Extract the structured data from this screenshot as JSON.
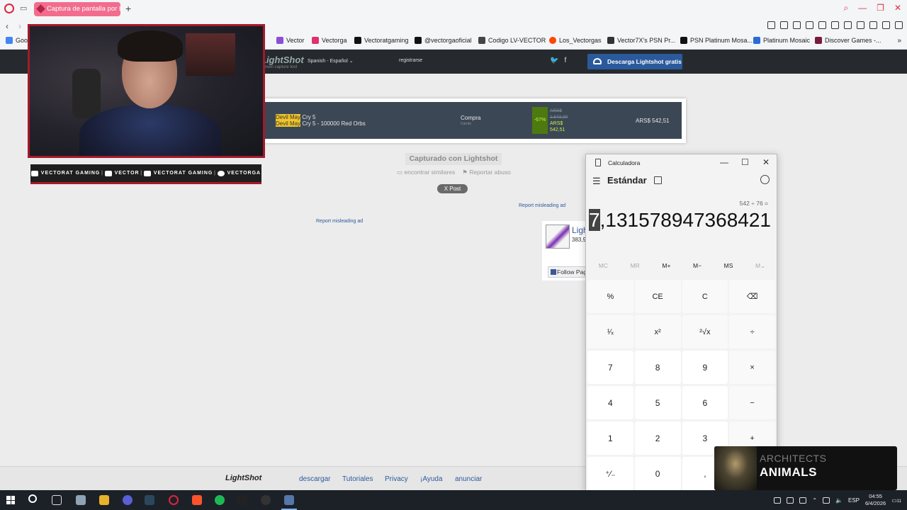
{
  "browser": {
    "tab_title": "Captura de pantalla por Li",
    "bookmarks": [
      {
        "label": "Goog",
        "color": "#4285f4"
      },
      {
        "label": "Vector",
        "color": "#8a4fd6"
      },
      {
        "label": "Vectorga",
        "color": "#e1306c"
      },
      {
        "label": "Vectoratgaming",
        "color": "#111111"
      },
      {
        "label": "@vectorgaoficial",
        "color": "#111111"
      },
      {
        "label": "Codigo LV-VECTOR",
        "color": "#444444"
      },
      {
        "label": "Los_Vectorgas",
        "color": "#ff4500"
      },
      {
        "label": "Vector7X's PSN Pr...",
        "color": "#333333"
      },
      {
        "label": "PSN Platinum Mosa...",
        "color": "#111111"
      },
      {
        "label": "Platinum Mosaic",
        "color": "#2a6bd6"
      },
      {
        "label": "Discover Games -...",
        "color": "#7a1b3a"
      }
    ]
  },
  "lightshot": {
    "logo": "LightShot",
    "tagline": "screen capture tool",
    "language": "Spanish - Español",
    "register": "registrarse",
    "download_button": "Descarga Lightshot gratis",
    "captured_label": "Capturado con Lightshot",
    "find_similar": "encontrar similares",
    "report_abuse": "Reportar abuso",
    "x_post": "X Post",
    "report_ad_1": "Report misleading ad",
    "report_ad_2": "Report misleading ad",
    "screenshot": {
      "game_line1_hl": "Devil May",
      "game_line1_rest": " Cry 5",
      "game_line2_hl": "Devil May",
      "game_line2_rest": " Cry 5 - 100000 Red Orbs",
      "compra": "Compra",
      "carrito": "Carrito",
      "discount": "-67%",
      "old_price_1": "ARS$",
      "old_price_2": "1.643,99",
      "new_price_1": "ARS$",
      "new_price_2": "542,51",
      "total": "ARS$ 542,51"
    },
    "fb": {
      "name": "Ligh",
      "count": "383,9",
      "follow": "Follow Page"
    },
    "footer": {
      "logo": "LightShot",
      "links": [
        "descargar",
        "Tutoriales",
        "Privacy",
        "¡Ayuda",
        "anunciar"
      ]
    }
  },
  "webcam": {
    "socials": [
      {
        "icon": "youtube-icon",
        "label": "VECTORAT GAMING"
      },
      {
        "icon": "twitch-icon",
        "label": "VECTOR"
      },
      {
        "icon": "twitter-icon",
        "label": "VECTORAT GAMING"
      },
      {
        "icon": "instagram-icon",
        "label": "VECTORGA"
      }
    ]
  },
  "calculator": {
    "window_title": "Calculadora",
    "mode": "Estándar",
    "expression": "542 ÷ 76 =",
    "display_selected": "7",
    "display_rest": ",131578947368421",
    "memory": [
      "MC",
      "MR",
      "M+",
      "M−",
      "MS",
      "M⌄"
    ],
    "keys": [
      "%",
      "CE",
      "C",
      "⌫",
      "¹⁄ₓ",
      "x²",
      "²√x",
      "÷",
      "7",
      "8",
      "9",
      "×",
      "4",
      "5",
      "6",
      "−",
      "1",
      "2",
      "3",
      "+",
      "⁺⁄₋",
      "0",
      ",",
      "="
    ]
  },
  "now_playing": {
    "artist": "ARCHITECTS",
    "title": "ANIMALS"
  },
  "taskbar": {
    "lang": "ESP",
    "time": "04:55",
    "date": "6/4/2026",
    "notifications": "11"
  }
}
